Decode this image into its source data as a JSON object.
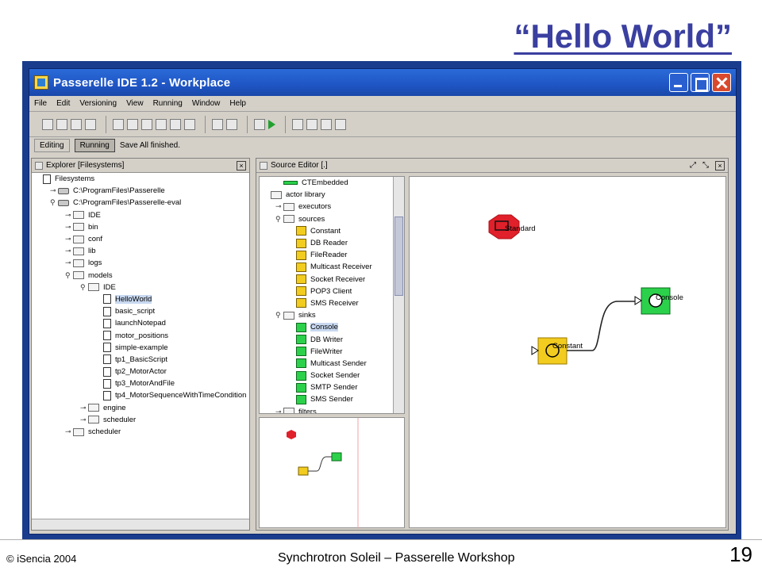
{
  "slide": {
    "title": "“Hello World”",
    "footer_left": "© iSencia 2004",
    "footer_center": "Synchrotron Soleil – Passerelle Workshop",
    "page_number": "19"
  },
  "window": {
    "title": "Passerelle IDE 1.2 - Workplace",
    "menu": [
      "File",
      "Edit",
      "Versioning",
      "View",
      "Running",
      "Window",
      "Help"
    ],
    "modes": [
      "Editing",
      "Running"
    ],
    "status": "Save All finished."
  },
  "explorer": {
    "title": "Explorer [Filesystems]",
    "items": [
      {
        "label": "Filesystems",
        "indent": 0,
        "icon": "doc",
        "toggle": ""
      },
      {
        "label": "C:\\ProgramFiles\\Passerelle",
        "indent": 1,
        "icon": "drive",
        "toggle": "o-"
      },
      {
        "label": "C:\\ProgramFiles\\Passerelle-eval",
        "indent": 1,
        "icon": "drive",
        "toggle": "o"
      },
      {
        "label": "IDE",
        "indent": 2,
        "icon": "folder",
        "toggle": "o-"
      },
      {
        "label": "bin",
        "indent": 2,
        "icon": "folder",
        "toggle": "o-"
      },
      {
        "label": "conf",
        "indent": 2,
        "icon": "folder",
        "toggle": "o-"
      },
      {
        "label": "lib",
        "indent": 2,
        "icon": "folder",
        "toggle": "o-"
      },
      {
        "label": "logs",
        "indent": 2,
        "icon": "folder",
        "toggle": "o-"
      },
      {
        "label": "models",
        "indent": 2,
        "icon": "folder",
        "toggle": "o"
      },
      {
        "label": "IDE",
        "indent": 3,
        "icon": "folder",
        "toggle": "o"
      },
      {
        "label": "HelloWorld",
        "indent": 4,
        "icon": "doc",
        "toggle": "",
        "selected": true
      },
      {
        "label": "basic_script",
        "indent": 4,
        "icon": "doc",
        "toggle": ""
      },
      {
        "label": "launchNotepad",
        "indent": 4,
        "icon": "doc",
        "toggle": ""
      },
      {
        "label": "motor_positions",
        "indent": 4,
        "icon": "doc",
        "toggle": ""
      },
      {
        "label": "simple-example",
        "indent": 4,
        "icon": "doc",
        "toggle": ""
      },
      {
        "label": "tp1_BasicScript",
        "indent": 4,
        "icon": "doc",
        "toggle": ""
      },
      {
        "label": "tp2_MotorActor",
        "indent": 4,
        "icon": "doc",
        "toggle": ""
      },
      {
        "label": "tp3_MotorAndFile",
        "indent": 4,
        "icon": "doc",
        "toggle": ""
      },
      {
        "label": "tp4_MotorSequenceWithTimeCondition",
        "indent": 4,
        "icon": "doc",
        "toggle": ""
      },
      {
        "label": "engine",
        "indent": 3,
        "icon": "folder",
        "toggle": "o-"
      },
      {
        "label": "scheduler",
        "indent": 3,
        "icon": "folder",
        "toggle": "o-"
      },
      {
        "label": "scheduler",
        "indent": 2,
        "icon": "folder",
        "toggle": "o-"
      }
    ]
  },
  "source_editor": {
    "title": "Source Editor [.]",
    "library": [
      {
        "label": "CTEmbedded",
        "indent": 1,
        "icon": "bar",
        "toggle": ""
      },
      {
        "label": "actor library",
        "indent": 0,
        "icon": "folder",
        "toggle": ""
      },
      {
        "label": "executors",
        "indent": 1,
        "icon": "folder",
        "toggle": "o-"
      },
      {
        "label": "sources",
        "indent": 1,
        "icon": "folder",
        "toggle": "o"
      },
      {
        "label": "Constant",
        "indent": 2,
        "icon": "act-y",
        "toggle": ""
      },
      {
        "label": "DB Reader",
        "indent": 2,
        "icon": "act-y",
        "toggle": ""
      },
      {
        "label": "FileReader",
        "indent": 2,
        "icon": "act-y",
        "toggle": ""
      },
      {
        "label": "Multicast Receiver",
        "indent": 2,
        "icon": "act-y",
        "toggle": ""
      },
      {
        "label": "Socket Receiver",
        "indent": 2,
        "icon": "act-y",
        "toggle": ""
      },
      {
        "label": "POP3 Client",
        "indent": 2,
        "icon": "act-y",
        "toggle": ""
      },
      {
        "label": "SMS Receiver",
        "indent": 2,
        "icon": "act-y",
        "toggle": ""
      },
      {
        "label": "sinks",
        "indent": 1,
        "icon": "folder",
        "toggle": "o"
      },
      {
        "label": "Console",
        "indent": 2,
        "icon": "act-g",
        "toggle": "",
        "selected": true
      },
      {
        "label": "DB Writer",
        "indent": 2,
        "icon": "act-g",
        "toggle": ""
      },
      {
        "label": "FileWriter",
        "indent": 2,
        "icon": "act-g",
        "toggle": ""
      },
      {
        "label": "Multicast Sender",
        "indent": 2,
        "icon": "act-g",
        "toggle": ""
      },
      {
        "label": "Socket Sender",
        "indent": 2,
        "icon": "act-g",
        "toggle": ""
      },
      {
        "label": "SMTP Sender",
        "indent": 2,
        "icon": "act-g",
        "toggle": ""
      },
      {
        "label": "SMS Sender",
        "indent": 2,
        "icon": "act-g",
        "toggle": ""
      },
      {
        "label": "filters",
        "indent": 1,
        "icon": "folder",
        "toggle": "o-"
      }
    ],
    "canvas": {
      "director_label": "Standard",
      "constant_label": "Constant",
      "console_label": "Console"
    }
  },
  "colors": {
    "title": "#3a3fa0",
    "director": "#e0202a",
    "source_actor": "#f2cc1e",
    "sink_actor": "#2bd14a"
  }
}
